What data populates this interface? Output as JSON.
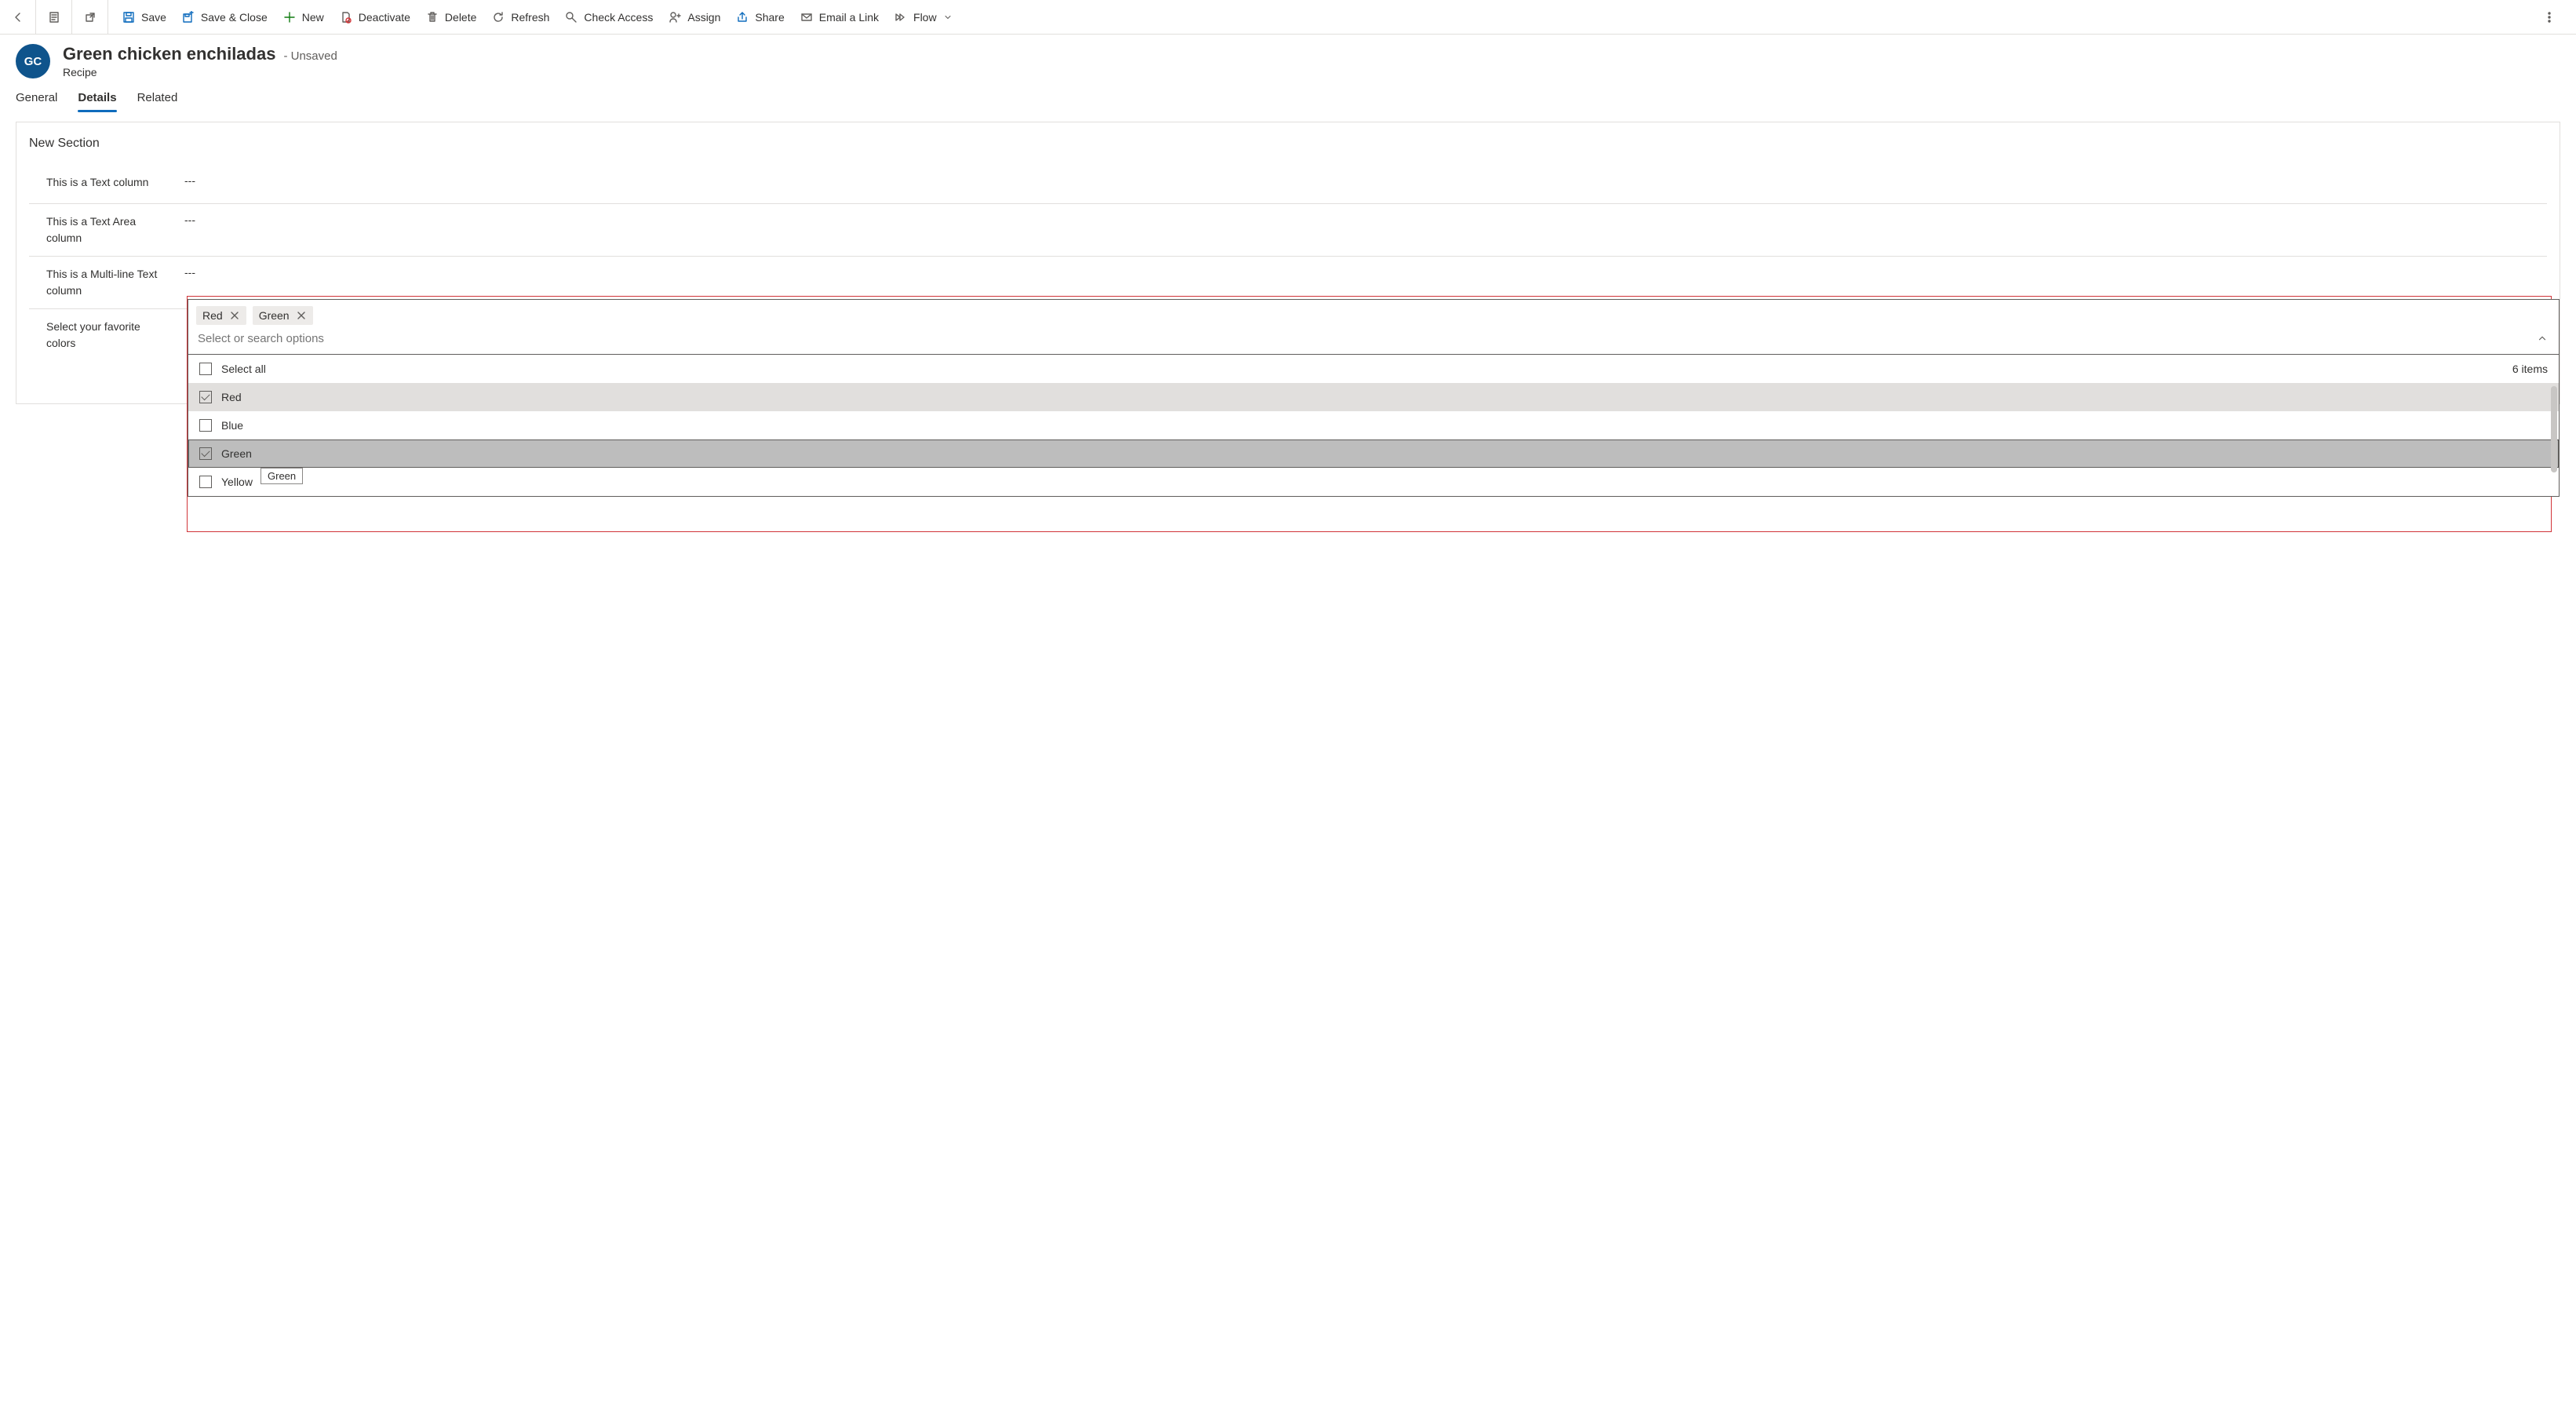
{
  "toolbar": {
    "save": "Save",
    "save_close": "Save & Close",
    "new": "New",
    "deactivate": "Deactivate",
    "delete": "Delete",
    "refresh": "Refresh",
    "check_access": "Check Access",
    "assign": "Assign",
    "share": "Share",
    "email_link": "Email a Link",
    "flow": "Flow"
  },
  "header": {
    "avatar_initials": "GC",
    "title": "Green chicken enchiladas",
    "status": "- Unsaved",
    "subtitle": "Recipe"
  },
  "tabs": {
    "general": "General",
    "details": "Details",
    "related": "Related"
  },
  "section": {
    "title": "New Section",
    "f1_label": "This is a Text column",
    "f1_value": "---",
    "f2_label": "This is a Text Area column",
    "f2_value": "---",
    "f3_label": "This is a Multi-line Text column",
    "f3_value": "---",
    "f4_label": "Select your favorite colors"
  },
  "combo": {
    "chips": {
      "red": "Red",
      "green": "Green"
    },
    "placeholder": "Select or search options",
    "select_all": "Select all",
    "count": "6 items",
    "options": {
      "red": "Red",
      "blue": "Blue",
      "green": "Green",
      "yellow": "Yellow"
    },
    "tooltip": "Green"
  }
}
